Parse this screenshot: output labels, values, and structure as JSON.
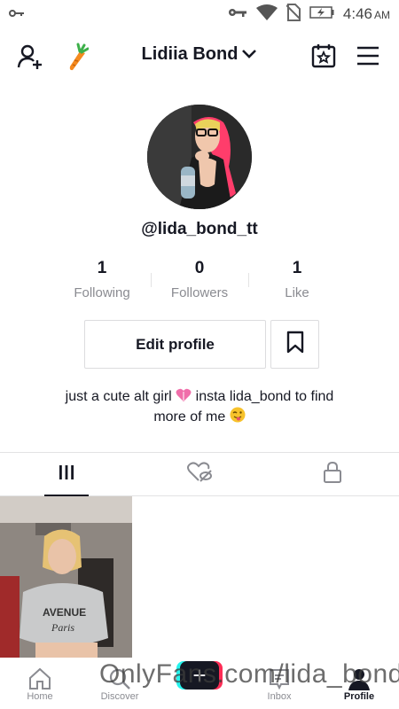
{
  "status_bar": {
    "time": "4:46",
    "ampm": "AM",
    "icons": [
      "key-icon",
      "wifi-icon",
      "no-sim-icon",
      "battery-charging-icon"
    ]
  },
  "top_nav": {
    "title": "Lidiia Bond",
    "icons": [
      "add-user-icon",
      "carrot-icon",
      "chevron-down-icon",
      "calendar-star-icon",
      "menu-icon"
    ]
  },
  "profile": {
    "handle": "@lida_bond_tt",
    "stats": [
      {
        "value": "1",
        "label": "Following"
      },
      {
        "value": "0",
        "label": "Followers"
      },
      {
        "value": "1",
        "label": "Like"
      }
    ],
    "edit_label": "Edit profile",
    "bio_line1": "just a cute alt girl",
    "bio_mid": "insta lida_bond to find",
    "bio_line2": "more of me"
  },
  "tabs": [
    {
      "name": "videos",
      "icon": "grid-icon",
      "active": true
    },
    {
      "name": "liked",
      "icon": "heart-hidden-icon",
      "active": false
    },
    {
      "name": "private",
      "icon": "lock-icon",
      "active": false
    }
  ],
  "bottom_nav": [
    {
      "label": "Home",
      "icon": "home-icon"
    },
    {
      "label": "Discover",
      "icon": "search-icon"
    },
    {
      "label": "",
      "icon": "create-icon"
    },
    {
      "label": "Inbox",
      "icon": "inbox-icon"
    },
    {
      "label": "Profile",
      "icon": "profile-icon",
      "active": true
    }
  ],
  "watermark": "OnlyFans.com/lida_bond",
  "colors": {
    "accent_red": "#fe2c55",
    "accent_cyan": "#25f4ee",
    "text": "#161823",
    "muted": "#8a8b91"
  }
}
